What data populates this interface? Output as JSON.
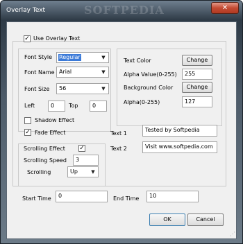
{
  "window": {
    "title": "Overlay Text",
    "watermark": "SOFTPEDIA",
    "close_glyph": "✕"
  },
  "use_overlay": {
    "label": "Use Overlay Text",
    "checked": true
  },
  "font": {
    "style_label": "Font Style",
    "style_value": "Regular",
    "name_label": "Font Name",
    "name_value": "Arial",
    "size_label": "Font Size",
    "size_value": "56",
    "left_label": "Left",
    "left_value": "0",
    "top_label": "Top",
    "top_value": "0"
  },
  "colors": {
    "text_color_label": "Text Color",
    "text_color_button": "Change",
    "alpha_value_label": "Alpha Value(0-255)",
    "alpha_value": "255",
    "bg_color_label": "Background Color",
    "bg_color_button": "Change",
    "alpha_label": "Alpha(0-255)",
    "alpha": "127"
  },
  "effects": {
    "shadow_label": "Shadow Effect",
    "shadow_checked": false,
    "fade_label": "Fade Effect",
    "fade_checked": true
  },
  "scrolling": {
    "effect_label": "Scrolling Effect",
    "effect_checked": true,
    "speed_label": "Scrolling Speed",
    "speed_value": "3",
    "direction_label": "Scrolling",
    "direction_value": "Up"
  },
  "texts": {
    "text1_label": "Text 1",
    "text1_value": "Tested by Softpedia",
    "text2_label": "Text 2",
    "text2_value": "Visit www.softpedia.com"
  },
  "times": {
    "start_label": "Start Time",
    "start_value": "0",
    "end_label": "End Time",
    "end_value": "10"
  },
  "buttons": {
    "ok": "OK",
    "cancel": "Cancel"
  },
  "icons": {
    "check": "✓",
    "dropdown": "▼",
    "grip": "⋰"
  }
}
